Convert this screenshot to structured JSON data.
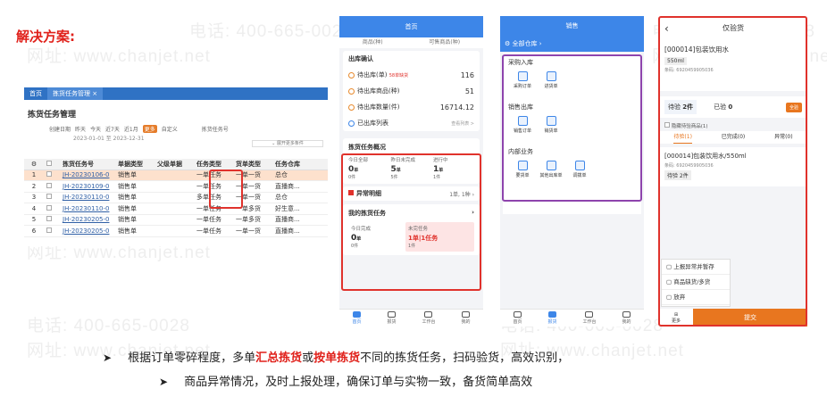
{
  "heading": "解决方案:",
  "watermark": {
    "phone": "电话: 400-665-0028",
    "site": "网址: www.chanjet.net"
  },
  "desktop": {
    "tabs": [
      "首页",
      "拣货任务管理 ×"
    ],
    "title": "拣货任务管理",
    "filter": [
      "创建日期",
      "昨天",
      "今天",
      "近7天",
      "近1月",
      "更多",
      "自定义",
      "拣货任务号"
    ],
    "dates": "2023-01-01 至 2023-12-31",
    "more_filter": "展开更多条件",
    "columns": [
      "⚙",
      "",
      "拣货任务号",
      "单据类型",
      "父级单据",
      "任务类型",
      "货单类型",
      "任务仓库"
    ],
    "rows": [
      [
        "1",
        "JH-20230106-0",
        "销售单",
        "",
        "一单任务",
        "一单一货",
        "总仓"
      ],
      [
        "2",
        "JH-20230109-0",
        "销售单",
        "",
        "一单任务",
        "一单一货",
        "直播商..."
      ],
      [
        "3",
        "JH-20230110-0",
        "销售单",
        "",
        "多单任务",
        "一单一货",
        "总仓"
      ],
      [
        "4",
        "JH-20230110-0",
        "销售单",
        "",
        "一单任务",
        "一单多货",
        "好生意..."
      ],
      [
        "5",
        "JH-20230205-0",
        "销售单",
        "",
        "一单任务",
        "一单多货",
        "直播商..."
      ],
      [
        "6",
        "JH-20230205-0",
        "销售单",
        "",
        "一单任务",
        "一单一货",
        "直播商..."
      ]
    ]
  },
  "phone1": {
    "title": "首页",
    "subtabs": [
      "商品(种)",
      "可售商品(种)"
    ],
    "outbound_title": "出库确认",
    "outbound": [
      {
        "label": "待出库(单)",
        "note": "58单缺货",
        "value": "116"
      },
      {
        "label": "待出库商品(种)",
        "note": "",
        "value": "51"
      },
      {
        "label": "待出库数量(件)",
        "note": "",
        "value": "16714.12"
      }
    ],
    "outbound_done": "已出库列表",
    "outbound_more": "查看列表 >",
    "pick_title": "拣货任务概况",
    "pick_stats": [
      {
        "label": "今日全部",
        "num": "0",
        "unit": "单",
        "sub": "0件"
      },
      {
        "label": "昨日未完成",
        "num": "5",
        "unit": "单",
        "sub": "5件"
      },
      {
        "label": "进行中",
        "num": "1",
        "unit": "单",
        "sub": "1件"
      }
    ],
    "abnormal": "异常明细",
    "abnormal_val": "1单, 1种",
    "my_title": "我的拣货任务",
    "my_stats": [
      {
        "label": "今日完成",
        "num": "0",
        "unit": "单",
        "sub": "0件"
      },
      {
        "label": "未完任务",
        "num": "1单|1任务",
        "unit": "",
        "sub": "1件"
      }
    ],
    "nav": [
      "首页",
      "报货",
      "工作台",
      "我的"
    ]
  },
  "phone2": {
    "title": "销售",
    "warehouse": "全部仓库",
    "sections": [
      {
        "name": "采购入库",
        "items": [
          "采购订单",
          "进货单"
        ]
      },
      {
        "name": "销售出库",
        "items": [
          "销售订单",
          "销货单"
        ]
      },
      {
        "name": "内部业务",
        "items": [
          "要货单",
          "其他出库单",
          "调拨单"
        ]
      }
    ],
    "nav": [
      "首页",
      "报货",
      "工作台",
      "我的"
    ]
  },
  "phone3": {
    "title": "仅验货",
    "product": "[000014]包装饮用水",
    "spec": "550ml",
    "barcode": "条码: 6920459905036",
    "pending_label": "待验",
    "pending_value": "2件",
    "checked_label": "已验",
    "checked_value": "0",
    "tag": "全验",
    "hide_done": "隐藏待验商品(1)",
    "tabs": [
      "待验(1)",
      "已完成(0)",
      "异常(0)"
    ],
    "item_title": "[000014]包装饮用水/550ml",
    "item_barcode": "条码: 6920459905036",
    "item_pending": "待验 2件",
    "menu": [
      "上报异常并暂存",
      "商品缺货/多货",
      "放弃"
    ],
    "more": "更多",
    "submit": "提交"
  },
  "bullets": [
    {
      "pre": "根据订单零碎程度，多单",
      "red1": "汇总拣货",
      "mid": "或",
      "red2": "按单拣货",
      "post": "不同的拣货任务，扫码验货，高效识别，"
    },
    {
      "pre": "商品异常情况，及时上报处理，确保订单与实物一致，备货简单高效"
    }
  ],
  "colors": {
    "accent": "#3d86e8",
    "highlight": "#e0322c",
    "orange": "#e8761f",
    "purple": "#8e44ad"
  }
}
